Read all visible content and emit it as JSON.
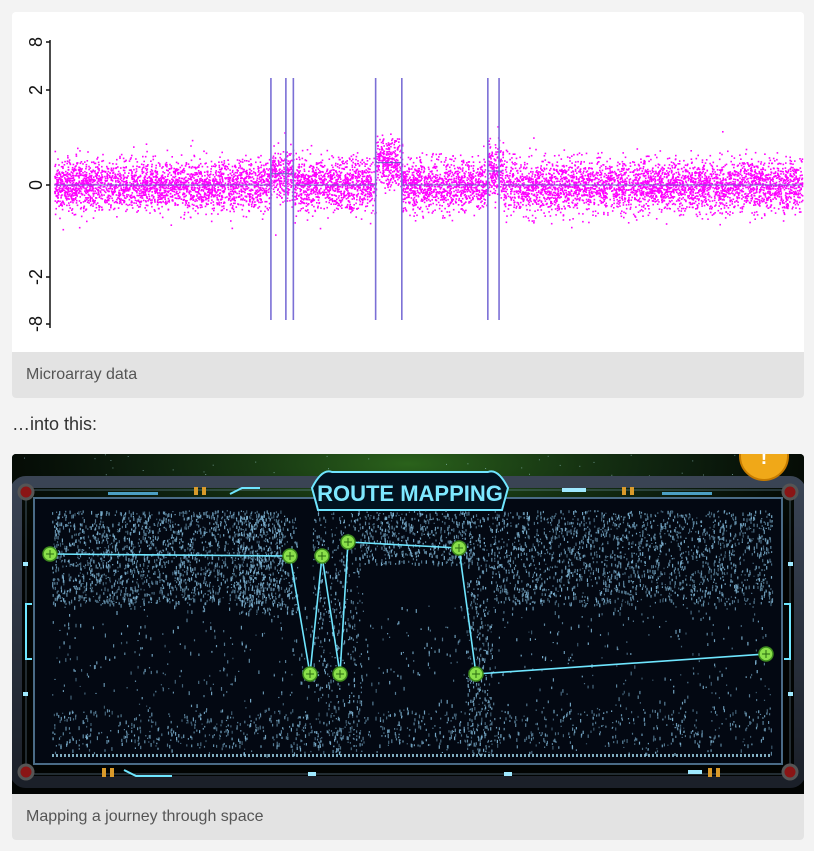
{
  "figure1": {
    "caption": "Microarray data",
    "chart_data": {
      "type": "scatter",
      "y_ticks": [
        "8",
        "2",
        "0",
        "-2",
        "-8"
      ],
      "point_color": "#ff00ff",
      "breakpoint_color": "#7b6fd6",
      "segments": [
        {
          "from": 0.0,
          "to": 0.29,
          "level": 0.0
        },
        {
          "from": 0.29,
          "to": 0.32,
          "level": 0.4
        },
        {
          "from": 0.32,
          "to": 0.43,
          "level": 0.0
        },
        {
          "from": 0.43,
          "to": 0.465,
          "level": 0.8
        },
        {
          "from": 0.465,
          "to": 0.58,
          "level": 0.0
        },
        {
          "from": 0.58,
          "to": 0.6,
          "level": 0.5
        },
        {
          "from": 0.6,
          "to": 1.0,
          "level": 0.0
        }
      ],
      "breakpoints": [
        0.29,
        0.31,
        0.32,
        0.43,
        0.465,
        0.58,
        0.595
      ]
    }
  },
  "between_text": "…into this:",
  "figure2": {
    "caption": "Mapping a journey through space",
    "game_title": "ROUTE MAPPING",
    "accent_color": "#6fe6ff",
    "node_color": "#8be04a",
    "alert_glyph": "!"
  }
}
